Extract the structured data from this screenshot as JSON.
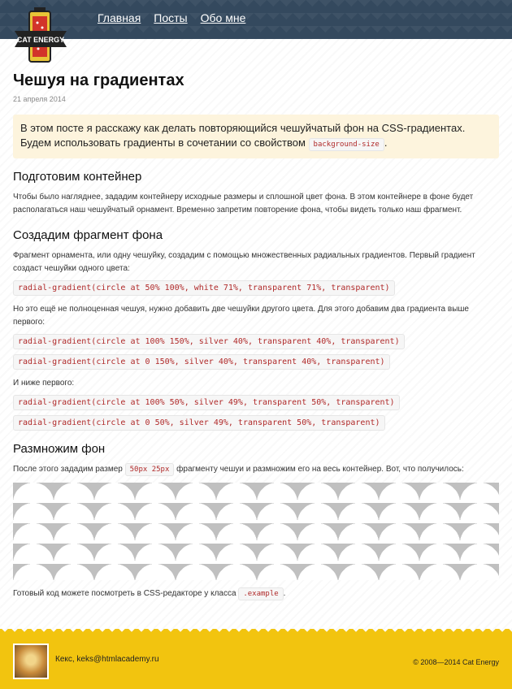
{
  "header": {
    "nav": [
      "Главная",
      "Посты",
      "Обо мне"
    ],
    "logo_text": "CAT ENERGY"
  },
  "post": {
    "title": "Чешуя на градиентах",
    "date": "21 апреля 2014",
    "intro_text": "В этом посте я расскажу как делать повторяющийся чешуйчатый фон на CSS-градиентах. Будем использовать градиенты в сочетании со свойством",
    "intro_code": "background-size",
    "intro_end": ".",
    "sections": [
      {
        "heading": "Подготовим контейнер",
        "text": "Чтобы было нагляднее, зададим контейнеру исходные размеры и сплошной цвет фона. В этом контейнере в фоне будет располагаться наш чешуйчатый орнамент. Временно запретим повторение фона, чтобы видеть только наш фрагмент."
      },
      {
        "heading": "Создадим фрагмент фона",
        "text1": "Фрагмент орнамента, или одну чешуйку, создадим с помощью множественных радиальных градиентов. Первый градиент создаст чешуйки одного цвета:",
        "code1": "radial-gradient(circle at 50% 100%, white 71%, transparent 71%, transparent)",
        "text2": "Но это ещё не полноценная чешуя, нужно добавить две чешуйки другого цвета. Для этого добавим два градиента выше первого:",
        "code2a": "radial-gradient(circle at 100% 150%, silver 40%, transparent 40%, transparent)",
        "code2b": "radial-gradient(circle at 0 150%, silver 40%, transparent 40%, transparent)",
        "text3": "И ниже первого:",
        "code3a": "radial-gradient(circle at 100% 50%, silver 49%, transparent 50%, transparent)",
        "code3b": "radial-gradient(circle at 0 50%, silver 49%, transparent 50%, transparent)"
      },
      {
        "heading": "Размножим фон",
        "text_before": "После этого зададим размер",
        "code": "50px 25px",
        "text_after": "фрагменту чешуи и размножим его на весь контейнер. Вот, что получилось:"
      }
    ],
    "final_text": "Готовый код можете посмотреть в CSS-редакторе у класса",
    "final_code": ".example",
    "final_end": "."
  },
  "footer": {
    "author": "Кекс, keks@htmlacademy.ru",
    "copyright": "© 2008—2014 Cat Energy"
  },
  "colors": {
    "header_bg": "#34495e",
    "footer_bg": "#f2c40f",
    "intro_bg": "#fdf4dd",
    "code_color": "#b02a2a"
  }
}
